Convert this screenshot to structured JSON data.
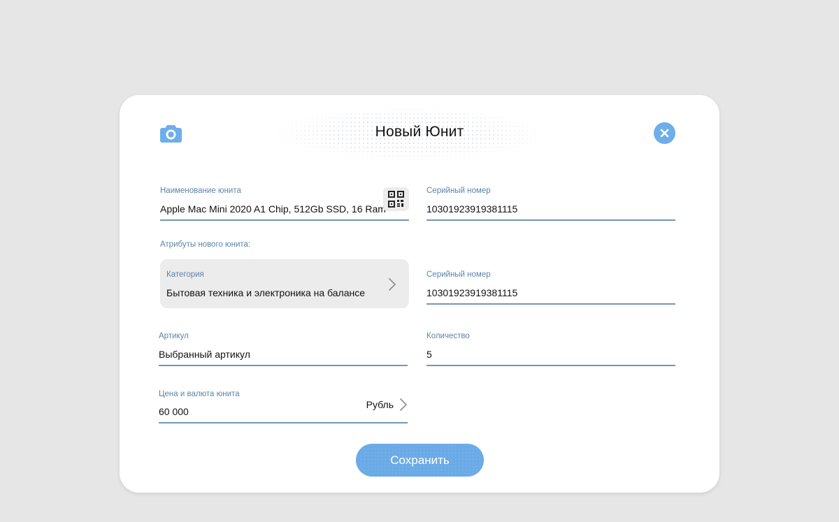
{
  "header": {
    "title": "Новый Юнит",
    "camera_icon": "camera-icon",
    "close_icon": "close-icon"
  },
  "form": {
    "name": {
      "label": "Наименование юнита",
      "value": "Apple Mac Mini 2020 A1 Chip, 512Gb SSD, 16 Ram",
      "qr_icon": "qr-code-icon"
    },
    "serial_1": {
      "label": "Серийный номер",
      "value": "10301923919381115"
    },
    "attributes_label": "Атрибуты нового юнита:",
    "category": {
      "label": "Категория",
      "value": "Бытовая техника и электроника на балансе"
    },
    "serial_2": {
      "label": "Серийный номер",
      "value": "10301923919381115"
    },
    "article": {
      "label": "Артикул",
      "value": "Выбранный артикул"
    },
    "quantity": {
      "label": "Количество",
      "value": "5"
    },
    "price": {
      "label": "Цена и валюта юнита",
      "value": "60 000",
      "currency": "Рубль"
    },
    "save_label": "Сохранить"
  },
  "colors": {
    "accent": "#6eaeea",
    "label": "#5b84aa",
    "underline": "#7496b8",
    "background": "#e6e6e6"
  }
}
